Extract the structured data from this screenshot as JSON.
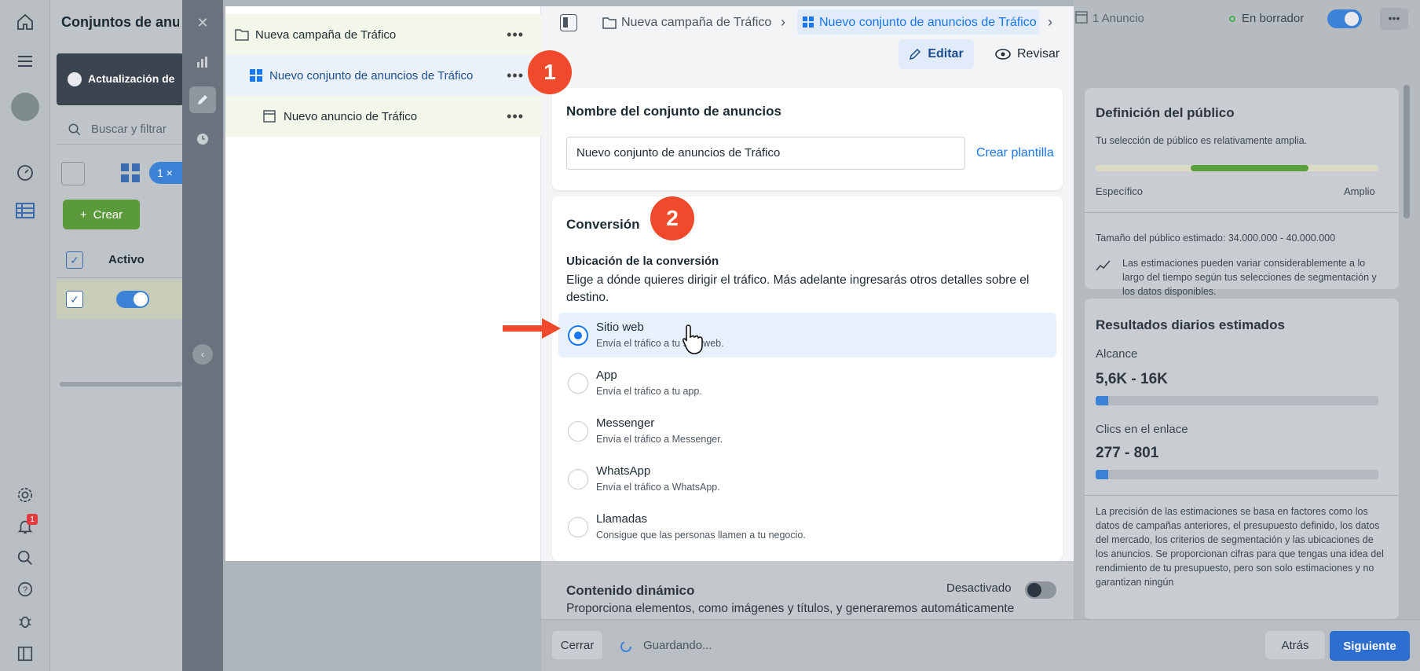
{
  "background": {
    "page_title": "Conjuntos de anu",
    "banner": "Actualización de",
    "search_placeholder": "Buscar y filtrar",
    "create_label": "Crear",
    "selected_chip": "1 ×",
    "col_active": "Activo"
  },
  "tree": {
    "items": [
      {
        "label": "Nueva campaña de Tráfico"
      },
      {
        "label": "Nuevo conjunto de anuncios de Tráfico"
      },
      {
        "label": "Nuevo anuncio de Tráfico"
      }
    ]
  },
  "topbar": {
    "crumbs": [
      "Nueva campaña de Tráfico",
      "Nuevo conjunto de anuncios de Tráfico",
      "1 Anuncio"
    ],
    "status": "En borrador",
    "edit_label": "Editar",
    "review_label": "Revisar"
  },
  "name_section": {
    "title": "Nombre del conjunto de anuncios",
    "value": "Nuevo conjunto de anuncios de Tráfico",
    "template_link": "Crear plantilla"
  },
  "conversion": {
    "title": "Conversión",
    "location_label": "Ubicación de la conversión",
    "location_help": "Elige a dónde quieres dirigir el tráfico. Más adelante ingresarás otros detalles sobre el destino.",
    "options": [
      {
        "title": "Sitio web",
        "desc": "Envía el tráfico a tu sitio web.",
        "selected": true
      },
      {
        "title": "App",
        "desc": "Envía el tráfico a tu app.",
        "selected": false
      },
      {
        "title": "Messenger",
        "desc": "Envía el tráfico a Messenger.",
        "selected": false
      },
      {
        "title": "WhatsApp",
        "desc": "Envía el tráfico a WhatsApp.",
        "selected": false
      },
      {
        "title": "Llamadas",
        "desc": "Consigue que las personas llamen a tu negocio.",
        "selected": false
      }
    ]
  },
  "dynamic": {
    "title": "Contenido dinámico",
    "toggle_label": "Desactivado",
    "desc": "Proporciona elementos, como imágenes y títulos, y generaremos automáticamente"
  },
  "footer": {
    "close_label": "Cerrar",
    "saving_label": "Guardando...",
    "back_label": "Atrás",
    "next_label": "Siguiente"
  },
  "audience": {
    "title": "Definición del público",
    "subtitle": "Tu selección de público es relativamente amplia.",
    "left_label": "Específico",
    "right_label": "Amplio",
    "size_label": "Tamaño del público estimado: 34.000.000 - 40.000.000",
    "note": "Las estimaciones pueden variar considerablemente a lo largo del tiempo según tus selecciones de segmentación y los datos disponibles."
  },
  "results": {
    "title": "Resultados diarios estimados",
    "reach_label": "Alcance",
    "reach_value": "5,6K - 16K",
    "clicks_label": "Clics en el enlace",
    "clicks_value": "277 - 801",
    "disclaimer": "La precisión de las estimaciones se basa en factores como los datos de campañas anteriores, el presupuesto definido, los datos del mercado, los criterios de segmentación y las ubicaciones de los anuncios. Se proporcionan cifras para que tengas una idea del rendimiento de tu presupuesto, pero son solo estimaciones y no garantizan ningún"
  },
  "annotations": {
    "step1": "1",
    "step2": "2"
  },
  "nav": {
    "notif_count": "1"
  },
  "colors": {
    "accent": "#1877f2",
    "badge": "#ef4a2b",
    "create_green": "#42b72a"
  }
}
